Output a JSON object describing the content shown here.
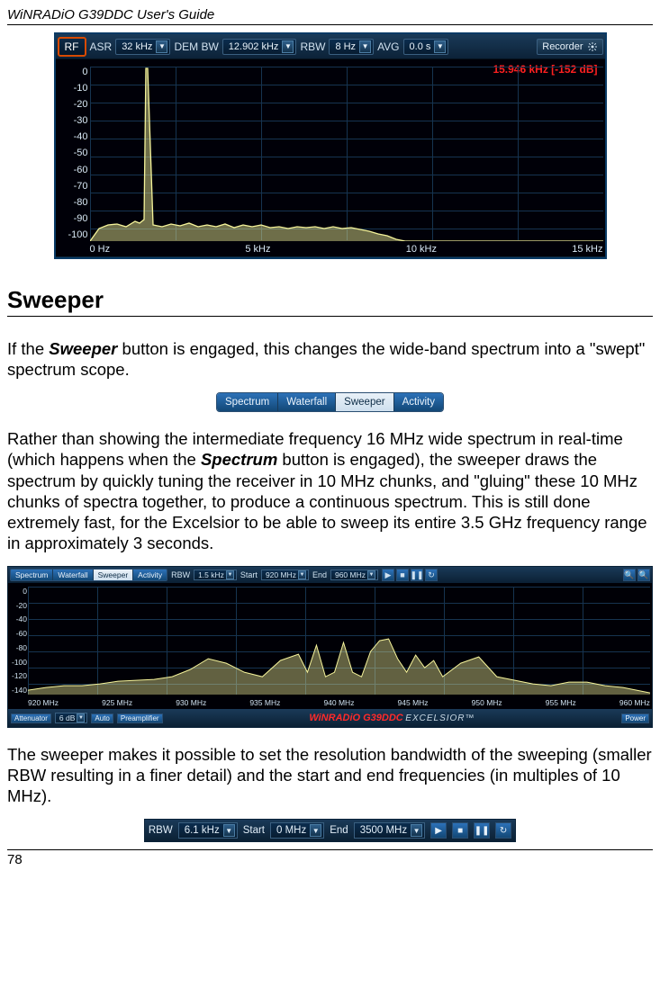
{
  "header": "WiNRADiO G39DDC User's Guide",
  "fig1": {
    "toolbar": {
      "rf_label": "RF",
      "asr_label": "ASR",
      "asr_value": "32 kHz",
      "dembw_label": "DEM BW",
      "dembw_value": "12.902 kHz",
      "rbw_label": "RBW",
      "rbw_value": "8 Hz",
      "avg_label": "AVG",
      "avg_value": "0.0 s",
      "recorder_label": "Recorder"
    },
    "status": "15.946 kHz [-152 dB]",
    "yaxis": [
      "0",
      "-10",
      "-20",
      "-30",
      "-40",
      "-50",
      "-60",
      "-70",
      "-80",
      "-90",
      "-100"
    ],
    "xaxis": [
      "0 Hz",
      "5 kHz",
      "10 kHz",
      "15 kHz"
    ]
  },
  "section_heading": "Sweeper",
  "para1_before": "If the ",
  "para1_bold": "Sweeper",
  "para1_after": " button is engaged, this changes the wide-band spectrum into a \"swept\" spectrum scope.",
  "fig2": {
    "tabs": [
      "Spectrum",
      "Waterfall",
      "Sweeper",
      "Activity"
    ]
  },
  "para2_before": "Rather than showing the intermediate frequency 16 MHz wide spectrum in real-time (which happens when the ",
  "para2_bold": "Spectrum",
  "para2_after": " button is engaged), the sweeper draws the spectrum by quickly tuning the receiver in 10 MHz chunks, and \"gluing\" these 10 MHz chunks of spectra together, to produce a continuous spectrum. This is still done extremely fast, for the Excelsior to be able to sweep its entire 3.5 GHz frequency range in approximately 3 seconds.",
  "fig3": {
    "toptabs": [
      "Spectrum",
      "Waterfall",
      "Sweeper",
      "Activity"
    ],
    "rbw_label": "RBW",
    "rbw_value": "1.5 kHz",
    "start_label": "Start",
    "start_value": "920 MHz",
    "end_label": "End",
    "end_value": "960 MHz",
    "yaxis": [
      "0",
      "-20",
      "-40",
      "-60",
      "-80",
      "-100",
      "-120",
      "-140"
    ],
    "xaxis": [
      "920 MHz",
      "925 MHz",
      "930 MHz",
      "935 MHz",
      "940 MHz",
      "945 MHz",
      "950 MHz",
      "955 MHz",
      "960 MHz"
    ],
    "bottom": {
      "att_label": "Attenuator",
      "att_value": "6 dB",
      "auto_label": "Auto",
      "preamp_label": "Preamplifier",
      "brand_win": "WiNRADiO G39DDC",
      "brand_exc": " EXCELSIOR™",
      "power_label": "Power"
    }
  },
  "para3": "The sweeper makes it possible to set the resolution bandwidth of the sweeping (smaller RBW resulting in a finer detail) and the start and end frequencies (in multiples of 10 MHz).",
  "fig4": {
    "rbw_label": "RBW",
    "rbw_value": "6.1 kHz",
    "start_label": "Start",
    "start_value": "0 MHz",
    "end_label": "End",
    "end_value": "3500 MHz"
  },
  "pagenum": "78",
  "chart_data": [
    {
      "type": "line",
      "title": "RF spectrum (top figure)",
      "xlabel": "Hz",
      "ylabel": "dB",
      "xlim": [
        0,
        16000
      ],
      "ylim": [
        -100,
        0
      ],
      "x": [
        0,
        500,
        1000,
        1500,
        1800,
        2000,
        3000,
        4000,
        5000,
        6000,
        7000,
        8000,
        9000,
        10000,
        11000,
        12000,
        13000,
        14000,
        15000,
        16000
      ],
      "y": [
        -100,
        -92,
        -90,
        -90,
        0,
        -90,
        -92,
        -91,
        -90,
        -92,
        -91,
        -92,
        -95,
        -96,
        -100,
        -100,
        -100,
        -100,
        -100,
        -100
      ],
      "annotations": [
        "15.946 kHz [-152 dB]"
      ]
    },
    {
      "type": "line",
      "title": "Sweeper wide-band spectrum 920–960 MHz",
      "xlabel": "MHz",
      "ylabel": "dB",
      "xlim": [
        920,
        960
      ],
      "ylim": [
        -140,
        0
      ],
      "x": [
        920,
        922,
        924,
        926,
        928,
        930,
        932,
        934,
        936,
        938,
        939,
        940,
        942,
        944,
        945,
        946,
        948,
        950,
        952,
        954,
        956,
        958,
        960
      ],
      "y": [
        -130,
        -128,
        -125,
        -125,
        -120,
        -115,
        -112,
        -105,
        -95,
        -105,
        -85,
        -110,
        -90,
        -110,
        -85,
        -80,
        -90,
        -100,
        -95,
        -110,
        -120,
        -120,
        -130
      ]
    }
  ]
}
